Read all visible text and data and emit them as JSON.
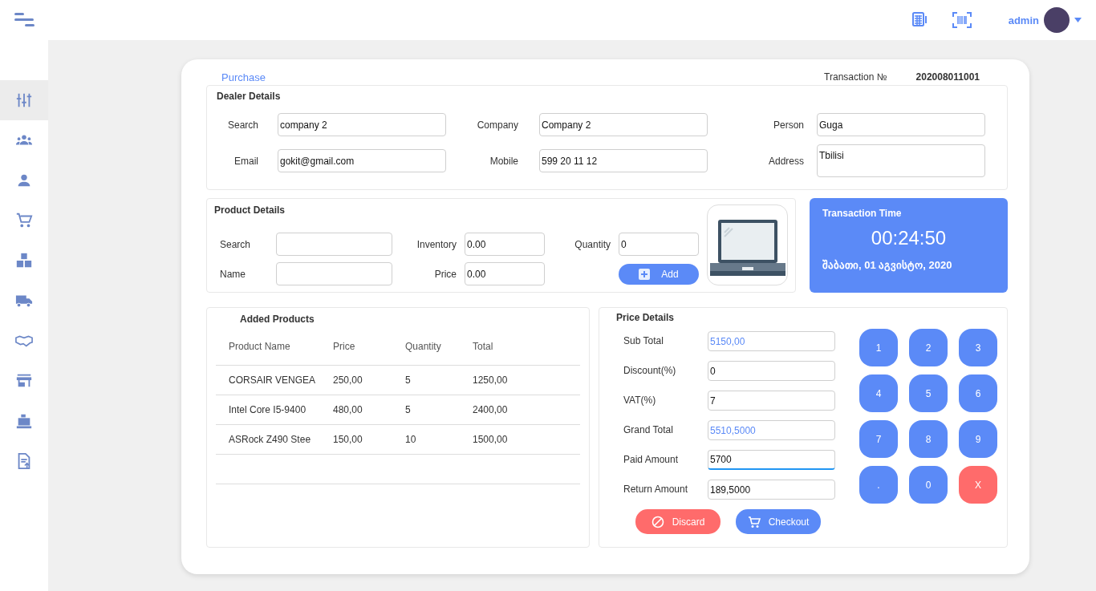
{
  "topbar": {
    "user": "admin"
  },
  "sidebar": {
    "items": [
      {
        "selected": true
      },
      {
        "selected": false
      },
      {
        "selected": false
      },
      {
        "selected": false
      },
      {
        "selected": false
      },
      {
        "selected": false
      },
      {
        "selected": false
      },
      {
        "selected": false
      },
      {
        "selected": false
      },
      {
        "selected": false
      }
    ]
  },
  "header": {
    "title": "Purchase",
    "transaction_label": "Transaction №",
    "transaction_number": "202008011001"
  },
  "dealer": {
    "title": "Dealer Details",
    "fields": [
      {
        "label": "Search",
        "value": "company 2",
        "kind": "input"
      },
      {
        "label": "Company",
        "value": "Company 2",
        "kind": "input"
      },
      {
        "label": "Person",
        "value": "Guga",
        "kind": "input"
      },
      {
        "label": "Email",
        "value": "gokit@gmail.com",
        "kind": "input"
      },
      {
        "label": "Mobile",
        "value": "599 20 11 12",
        "kind": "input"
      },
      {
        "label": "Address",
        "value": "Tbilisi",
        "kind": "textarea"
      }
    ]
  },
  "product": {
    "title": "Product Details",
    "fields": [
      {
        "label": "Search"
      },
      {
        "label": "Inventory",
        "value": "0.00"
      },
      {
        "label": "Quantity",
        "value": "0"
      },
      {
        "label": "Name"
      },
      {
        "label": "Price",
        "value": "0.00"
      }
    ],
    "add_button": "Add"
  },
  "transaction_time": {
    "title": "Transaction Time",
    "time": "00:24:50",
    "date": "შაბათი, 01 აგვისტო, 2020"
  },
  "added_products": {
    "title": "Added Products",
    "columns": [
      "Product Name",
      "Price",
      "Quantity",
      "Total"
    ],
    "rows": [
      [
        "CORSAIR VENGEA",
        "250,00",
        "5",
        "1250,00"
      ],
      [
        "Intel Core I5-9400",
        "480,00",
        "5",
        "2400,00"
      ],
      [
        "ASRock Z490 Stee",
        "150,00",
        "10",
        "1500,00"
      ]
    ]
  },
  "price": {
    "title": "Price Details",
    "fields": [
      {
        "label": "Sub Total",
        "value": "5150,00",
        "computed": true,
        "focused": false
      },
      {
        "label": "Discount(%)",
        "value": "0",
        "computed": false,
        "focused": false
      },
      {
        "label": "VAT(%)",
        "value": "7",
        "computed": false,
        "focused": false
      },
      {
        "label": "Grand Total",
        "value": "5510,5000",
        "computed": true,
        "focused": false
      },
      {
        "label": "Paid Amount",
        "value": "5700",
        "computed": false,
        "focused": true
      },
      {
        "label": "Return Amount",
        "value": "189,5000",
        "computed": false,
        "focused": false
      }
    ],
    "keypad": [
      {
        "label": "1",
        "kind": "digit"
      },
      {
        "label": "2",
        "kind": "digit"
      },
      {
        "label": "3",
        "kind": "digit"
      },
      {
        "label": "4",
        "kind": "digit"
      },
      {
        "label": "5",
        "kind": "digit"
      },
      {
        "label": "6",
        "kind": "digit"
      },
      {
        "label": "7",
        "kind": "digit"
      },
      {
        "label": "8",
        "kind": "digit"
      },
      {
        "label": "9",
        "kind": "digit"
      },
      {
        "label": ".",
        "kind": "digit"
      },
      {
        "label": "0",
        "kind": "digit"
      },
      {
        "label": "X",
        "kind": "clear"
      }
    ],
    "discard_button": "Discard",
    "checkout_button": "Checkout"
  }
}
